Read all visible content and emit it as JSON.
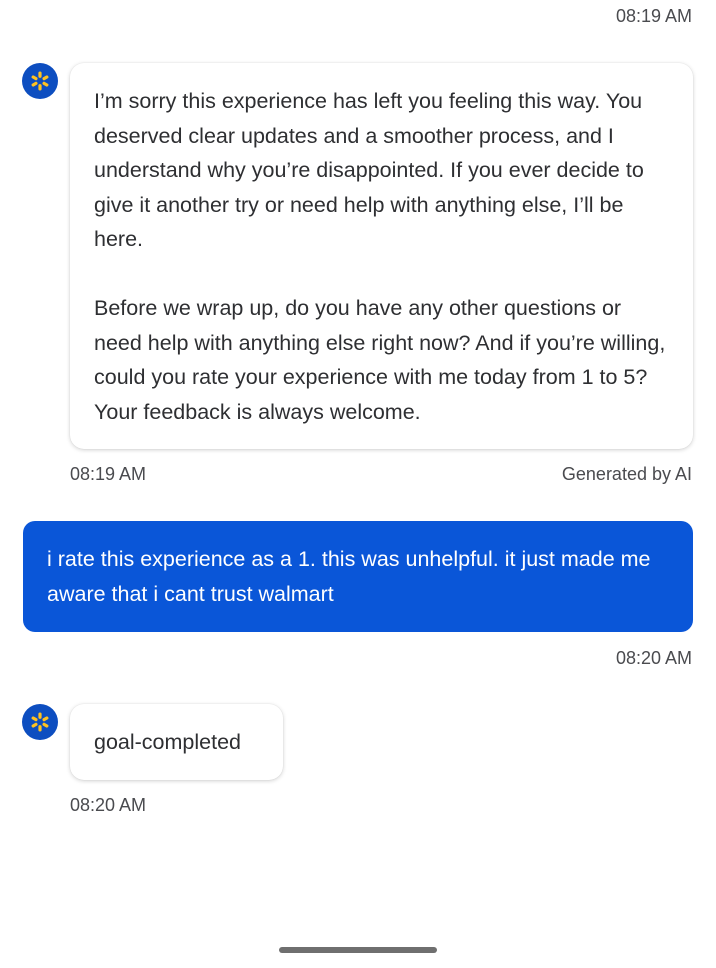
{
  "messages": {
    "prev_time": "08:19 AM",
    "bot_reply": {
      "paragraph_1": "I’m sorry this experience has left you feeling this way. You deserved clear updates and a smoother process, and I understand why you’re disappointed. If you ever decide to give it another try or need help with anything else, I’ll be here.",
      "paragraph_2": "Before we wrap up, do you have any other questions or need help with anything else right now? And if you’re willing, could you rate your experience with me today from 1 to 5? Your feedback is always welcome.",
      "time": "08:19 AM",
      "generated_label": "Generated by AI"
    },
    "user_message": {
      "text": "i rate this experience as a 1. this was unhelpful. it just made me aware that i cant trust walmart",
      "time": "08:20 AM"
    },
    "bot_final": {
      "text": "goal-completed",
      "time": "08:20 AM"
    }
  },
  "icons": {
    "bot_avatar": "walmart-spark-icon"
  },
  "colors": {
    "user_bubble": "#0a56d8",
    "avatar_bg": "#0d4ec0",
    "spark": "#ffc220"
  }
}
